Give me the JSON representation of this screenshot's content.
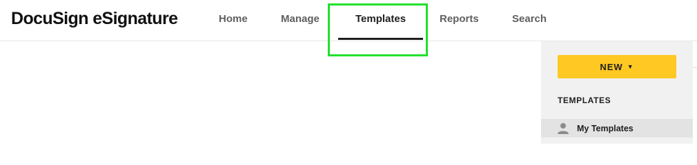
{
  "brand": {
    "title": "DocuSign eSignature"
  },
  "nav": {
    "items": [
      {
        "label": "Home"
      },
      {
        "label": "Manage"
      },
      {
        "label": "Templates",
        "active": true
      },
      {
        "label": "Reports"
      },
      {
        "label": "Search"
      }
    ]
  },
  "sidebar": {
    "new_button_label": "NEW",
    "new_button_caret": "▼",
    "section_title": "TEMPLATES",
    "items": [
      {
        "label": "My Templates",
        "icon": "person-icon"
      }
    ]
  },
  "colors": {
    "accent_button": "#ffc823",
    "highlight_box": "#22e02c",
    "active_underline": "#1e1e1e",
    "panel_background": "#f1f1f1",
    "selected_item_background": "#e3e3e3"
  }
}
